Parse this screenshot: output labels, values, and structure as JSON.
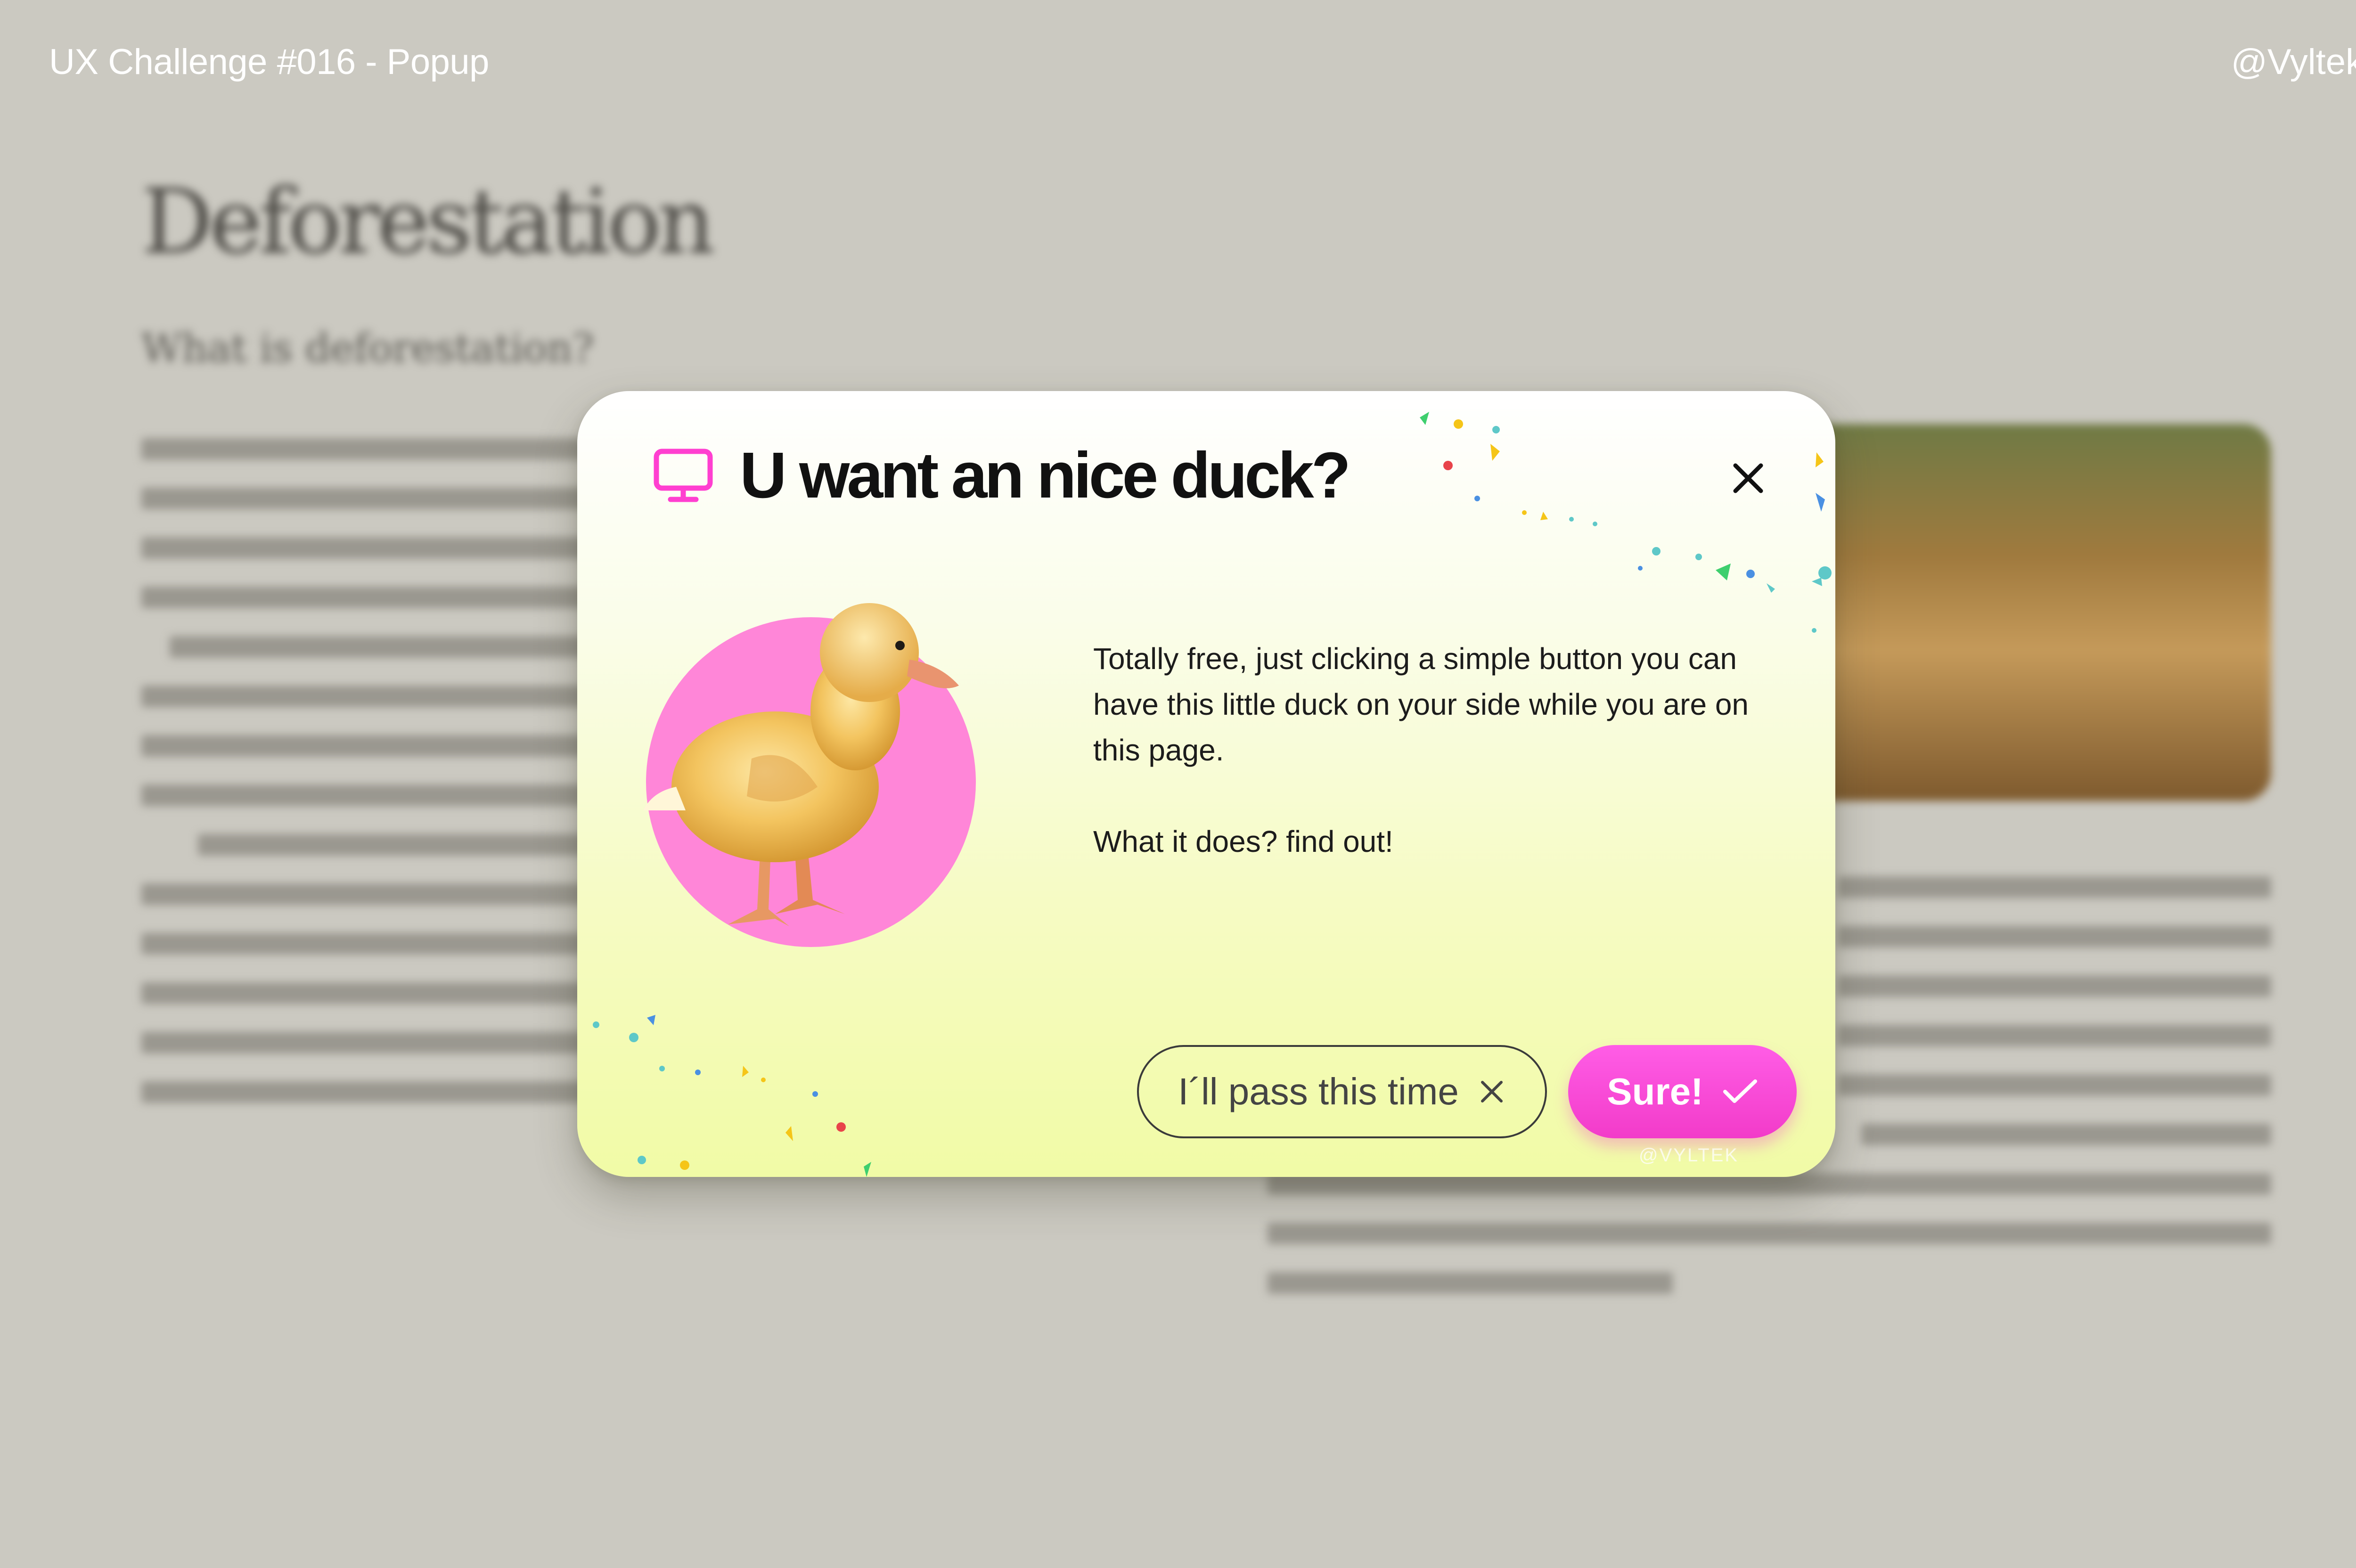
{
  "header": {
    "title": "UX Challenge #016 - Popup",
    "handle": "@Vyltek"
  },
  "background_article": {
    "heading": "Deforestation",
    "subheading": "What is deforestation?"
  },
  "popup": {
    "icon": "monitor-icon",
    "title": "U want an nice duck?",
    "close_icon": "close-icon",
    "description": [
      "Totally free, just clicking a simple button you can have this little duck on your side while you are on this page.",
      "What it does? find out!"
    ],
    "decline_label": "I´ll pass this time",
    "accept_label": "Sure!",
    "watermark": "@VYLTEK",
    "colors": {
      "accent": "#f23bc9",
      "circle": "#ff86d8",
      "popup_top": "#ffffff",
      "popup_bottom": "#f1fba6"
    }
  }
}
